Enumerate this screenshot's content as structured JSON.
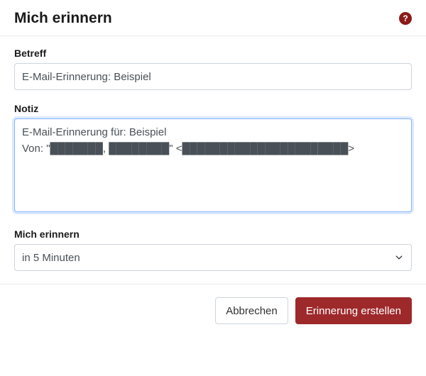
{
  "header": {
    "title": "Mich erinnern"
  },
  "form": {
    "subject": {
      "label": "Betreff",
      "value": "E-Mail-Erinnerung: Beispiel"
    },
    "note": {
      "label": "Notiz",
      "value": "E-Mail-Erinnerung für: Beispiel\nVon: \"███████, ████████\" <██████████████████████>"
    },
    "remind": {
      "label": "Mich erinnern",
      "selected": "in 5 Minuten"
    }
  },
  "footer": {
    "cancel_label": "Abbrechen",
    "submit_label": "Erinnerung erstellen"
  }
}
